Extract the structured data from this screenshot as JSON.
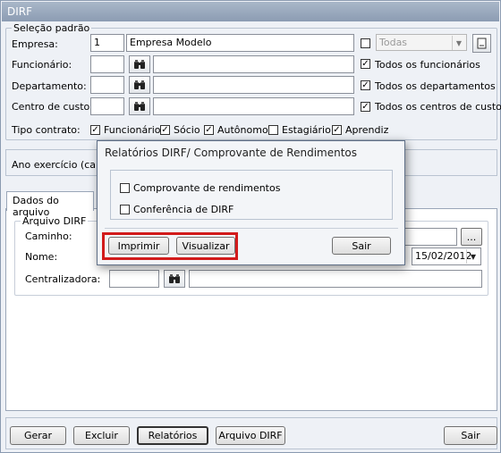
{
  "window": {
    "title": "DIRF"
  },
  "selecao": {
    "legend": "Seleção padrão",
    "empresa_label": "Empresa:",
    "empresa_code": "1",
    "empresa_name": "Empresa Modelo",
    "empresa_combo": "Todas",
    "funcionario_label": "Funcionário:",
    "todos_funcionarios": "Todos os funcionários",
    "departamento_label": "Departamento:",
    "todos_departamentos": "Todos os departamentos",
    "centro_label": "Centro de custo:",
    "todos_centros": "Todos os centros de custo",
    "tipo_label": "Tipo contrato:",
    "tipos": [
      {
        "label": "Funcionário",
        "checked": true
      },
      {
        "label": "Sócio",
        "checked": true
      },
      {
        "label": "Autônomo",
        "checked": true
      },
      {
        "label": "Estagiário",
        "checked": false
      },
      {
        "label": "Aprendiz",
        "checked": true
      }
    ]
  },
  "ano": {
    "label": "Ano exercício (cale"
  },
  "tabs": {
    "dados_arquivo": "Dados do arquivo"
  },
  "arquivo": {
    "legend": "Arquivo DIRF",
    "caminho_label": "Caminho:",
    "browse": "...",
    "nome_label": "Nome:",
    "date": "15/02/2012",
    "centralizadora_label": "Centralizadora:"
  },
  "footer": {
    "gerar": "Gerar",
    "excluir": "Excluir",
    "relatorios": "Relatórios",
    "arquivo_dirf": "Arquivo DIRF",
    "sair": "Sair"
  },
  "dialog": {
    "title": "Relatórios DIRF/ Comprovante de Rendimentos",
    "options": [
      {
        "label": "Comprovante de rendimentos",
        "checked": false
      },
      {
        "label": "Conferência de DIRF",
        "checked": false
      }
    ],
    "imprimir": "Imprimir",
    "visualizar": "Visualizar",
    "sair": "Sair"
  },
  "colors": {
    "highlight": "#d21b1b",
    "titlebar": "#8c9cb3"
  },
  "icons": {
    "binoculars": "binoculars-icon",
    "check": "check-icon",
    "dropdown": "chevron-down-icon"
  }
}
